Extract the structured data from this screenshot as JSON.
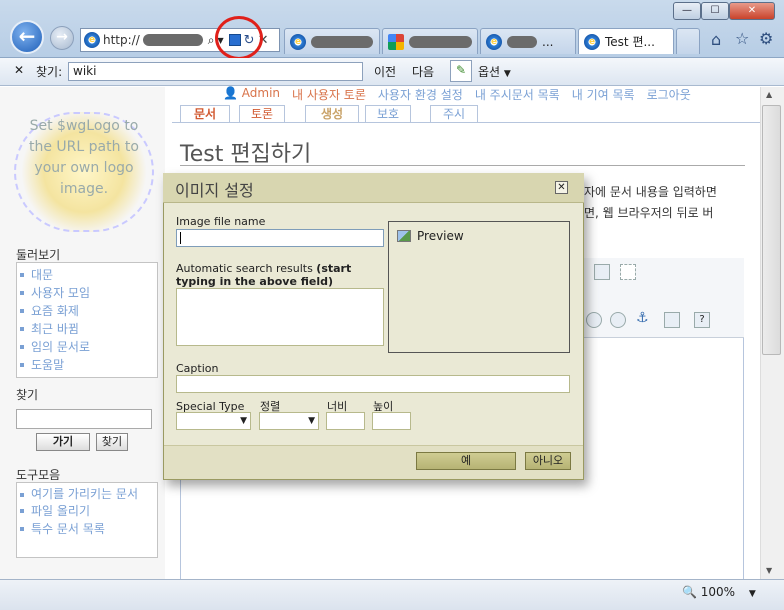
{
  "browser": {
    "address_prefix": "http://",
    "tabs": [
      {
        "label": ""
      },
      {
        "label": ""
      },
      {
        "label": "..."
      },
      {
        "label": "Test 편..."
      }
    ],
    "find": {
      "label": "찾기:",
      "value": "wiki",
      "prev_label": "이전",
      "next_label": "다음",
      "options_label": "옵션"
    },
    "zoom": "100%"
  },
  "wiki": {
    "user_links": [
      "Admin",
      "내 사용자 토론",
      "사용자 환경 설정",
      "내 주시문서 목록",
      "내 기여 목록",
      "로그아웃"
    ],
    "logo_text": "Set $wgLogo to the URL path to your own logo image.",
    "page_tabs": [
      "문서",
      "토론",
      "생성",
      "보호",
      "주시"
    ],
    "page_title": "Test 편집하기",
    "intro_line1": "자에 문서 내용을 입력하면",
    "intro_line2": "면, 웹 브라우저의 뒤로 버",
    "navigation": {
      "heading": "둘러보기",
      "items": [
        "대문",
        "사용자 모임",
        "요즘 화제",
        "최근 바뀜",
        "임의 문서로",
        "도움말"
      ]
    },
    "search": {
      "heading": "찾기",
      "go_label": "가기",
      "search_label": "찾기"
    },
    "toolbox": {
      "heading": "도구모음",
      "items": [
        "여기를 가리키는 문서",
        "파일 올리기",
        "특수 문서 목록"
      ]
    }
  },
  "dialog": {
    "title": "이미지 설정",
    "image_file_label": "Image file name",
    "auto_search_label": "Automatic search results",
    "auto_search_hint": "(start typing in the above field)",
    "preview_label": "Preview",
    "caption_label": "Caption",
    "special_type_label": "Special Type",
    "align_label": "정렬",
    "width_label": "너비",
    "height_label": "높이",
    "ok_label": "예",
    "cancel_label": "아니오"
  }
}
